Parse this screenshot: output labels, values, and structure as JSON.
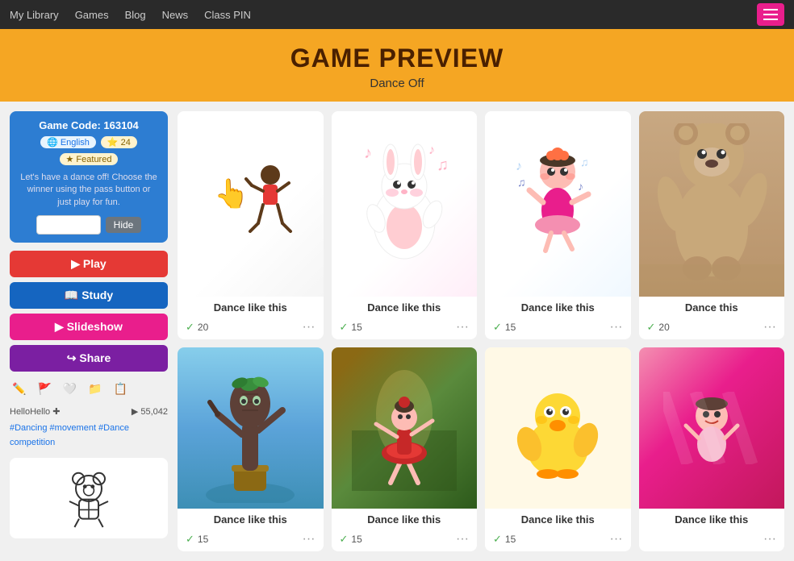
{
  "nav": {
    "items": [
      {
        "label": "My Library",
        "id": "my-library"
      },
      {
        "label": "Games",
        "id": "games"
      },
      {
        "label": "Blog",
        "id": "blog"
      },
      {
        "label": "News",
        "id": "news"
      },
      {
        "label": "Class PIN",
        "id": "class-pin"
      }
    ]
  },
  "header": {
    "title": "Game Preview",
    "subtitle": "Dance Off"
  },
  "sidebar": {
    "game_code_label": "Game Code: 163104",
    "badge_english": "🌐 English",
    "badge_count": "⭐ 24",
    "badge_featured": "★ Featured",
    "description": "Let's have a dance off! Choose the winner using the pass button or just play for fun.",
    "hide_placeholder": "",
    "hide_btn": "Hide",
    "play_btn": "▶ Play",
    "study_btn": "📖 Study",
    "slideshow_btn": "▶ Slideshow",
    "share_btn": "↪ Share",
    "user": "HelloHello ✚",
    "plays": "55,042",
    "tags": "#Dancing #movement #Dance competition"
  },
  "cards": [
    {
      "id": "card-1",
      "label": "Dance like this",
      "votes": "20",
      "bg": "gif-dancing-kid",
      "emoji": "🕺"
    },
    {
      "id": "card-2",
      "label": "Dance like this",
      "votes": "15",
      "bg": "gif-bunny",
      "emoji": "🐰"
    },
    {
      "id": "card-3",
      "label": "Dance like this",
      "votes": "15",
      "bg": "gif-baby",
      "emoji": "👶"
    },
    {
      "id": "card-4",
      "label": "Dance this",
      "votes": "20",
      "bg": "gif-bear-costume",
      "emoji": "🐻"
    },
    {
      "id": "card-5",
      "label": "Dance like this",
      "votes": "15",
      "bg": "gif-groot",
      "emoji": "🌱"
    },
    {
      "id": "card-6",
      "label": "Dance like this",
      "votes": "15",
      "bg": "gif-ballerina",
      "emoji": "💃"
    },
    {
      "id": "card-7",
      "label": "Dance like this",
      "votes": "15",
      "bg": "gif-duck",
      "emoji": "🐤"
    },
    {
      "id": "card-8",
      "label": "Dance like this",
      "votes": "",
      "bg": "gif-tiktok-bear",
      "emoji": "🐻"
    }
  ]
}
